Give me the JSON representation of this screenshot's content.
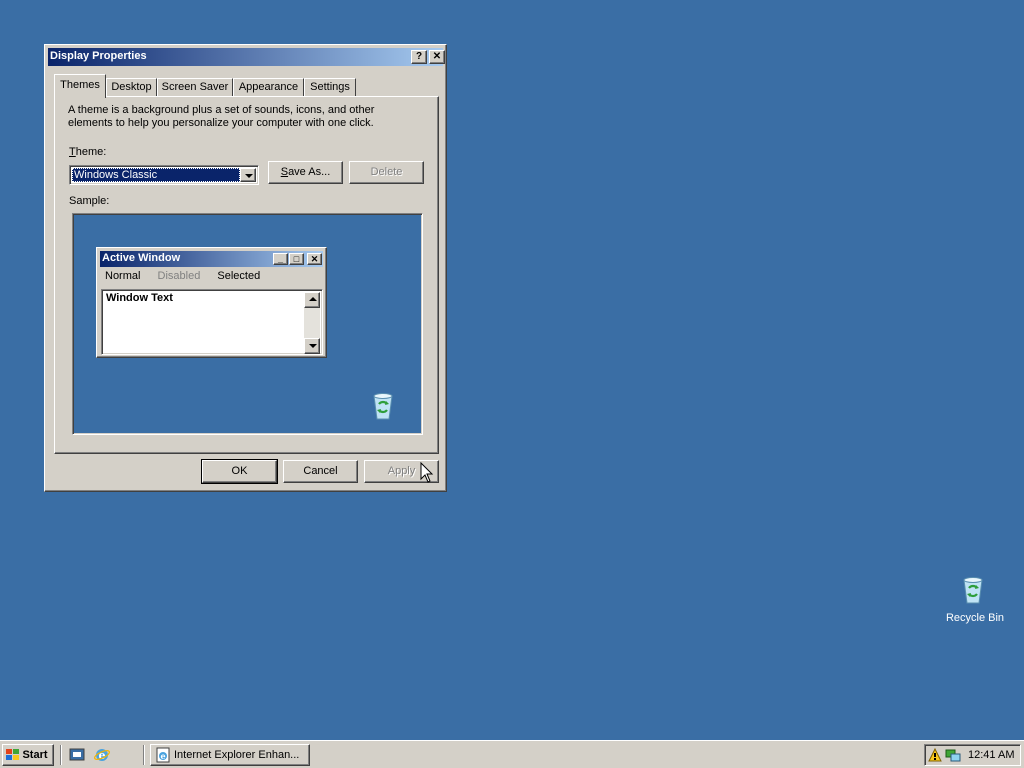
{
  "dialog": {
    "title": "Display Properties",
    "help_btn": "?",
    "close_btn": "✕",
    "tabs": [
      {
        "label": "Themes",
        "active": true
      },
      {
        "label": "Desktop",
        "active": false
      },
      {
        "label": "Screen Saver",
        "active": false
      },
      {
        "label": "Appearance",
        "active": false
      },
      {
        "label": "Settings",
        "active": false
      }
    ],
    "description": "A theme is a background plus a set of sounds, icons, and other elements to help you personalize your computer with one click.",
    "theme_label": "Theme:",
    "theme_value": "Windows Classic",
    "save_as_label": "Save As...",
    "delete_label": "Delete",
    "sample_label": "Sample:",
    "ok_label": "OK",
    "cancel_label": "Cancel",
    "apply_label": "Apply"
  },
  "sample": {
    "window_title": "Active Window",
    "menu": [
      "Normal",
      "Disabled",
      "Selected"
    ],
    "window_text": "Window Text"
  },
  "desktop": {
    "recycle_bin_label": "Recycle Bin"
  },
  "taskbar": {
    "start_label": "Start",
    "task_label": "Internet Explorer Enhan...",
    "clock": "12:41 AM"
  },
  "colors": {
    "desktop": "#3a6ea5",
    "face": "#d4d0c8",
    "title_start": "#0a246a",
    "title_end": "#a6caf0"
  }
}
